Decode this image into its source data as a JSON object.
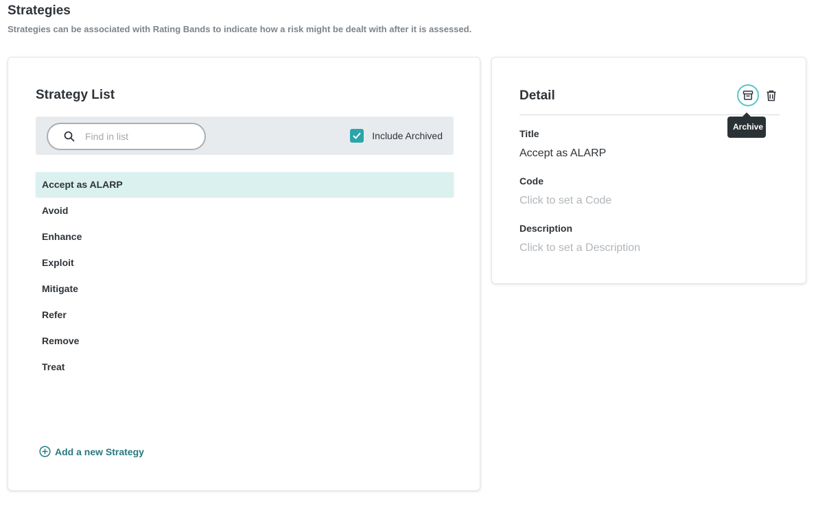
{
  "page": {
    "title": "Strategies",
    "subtitle": "Strategies can be associated with Rating Bands to indicate how a risk might be dealt with after it is assessed."
  },
  "list_panel": {
    "heading": "Strategy List",
    "search": {
      "placeholder": "Find in list",
      "value": ""
    },
    "include_archived": {
      "label": "Include Archived",
      "checked": true
    },
    "items": [
      {
        "label": "Accept as ALARP",
        "selected": true
      },
      {
        "label": "Avoid",
        "selected": false
      },
      {
        "label": "Enhance",
        "selected": false
      },
      {
        "label": "Exploit",
        "selected": false
      },
      {
        "label": "Mitigate",
        "selected": false
      },
      {
        "label": "Refer",
        "selected": false
      },
      {
        "label": "Remove",
        "selected": false
      },
      {
        "label": "Treat",
        "selected": false
      }
    ],
    "add_label": "Add a new Strategy"
  },
  "detail_panel": {
    "heading": "Detail",
    "tooltip": "Archive",
    "icons": {
      "archive": "archive-box-icon",
      "delete": "trash-icon"
    },
    "fields": {
      "title_label": "Title",
      "title_value": "Accept as ALARP",
      "code_label": "Code",
      "code_placeholder": "Click to set a Code",
      "description_label": "Description",
      "description_placeholder": "Click to set a Description"
    }
  },
  "colors": {
    "accent": "#2aa5aa",
    "selected_row": "#daf1ef",
    "link": "#26797d"
  }
}
